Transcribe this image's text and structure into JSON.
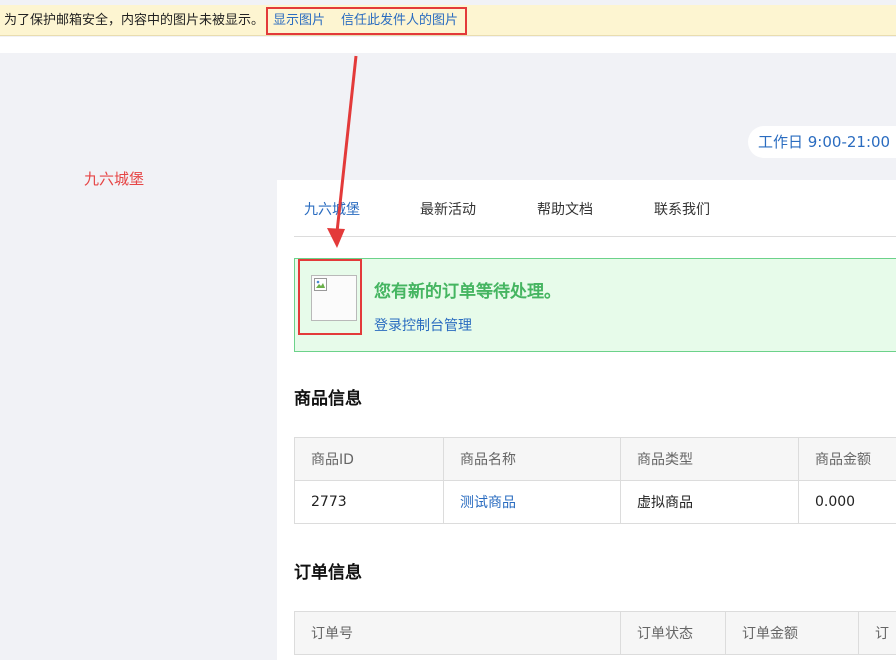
{
  "notice": {
    "text": "为了保护邮箱安全，内容中的图片未被显示。",
    "show_images": "显示图片",
    "trust_sender": "信任此发件人的图片"
  },
  "header": {
    "hours": "工作日 9:00-21:00",
    "brand": "九六城堡"
  },
  "nav": {
    "items": [
      "九六城堡",
      "最新活动",
      "帮助文档",
      "联系我们"
    ]
  },
  "alert": {
    "title": "您有新的订单等待处理。",
    "link": "登录控制台管理"
  },
  "product_section": {
    "title": "商品信息",
    "columns": [
      "商品ID",
      "商品名称",
      "商品类型",
      "商品金额"
    ],
    "row": [
      "2773",
      "测试商品",
      "虚拟商品",
      "0.000"
    ]
  },
  "order_section": {
    "title": "订单信息",
    "columns": [
      "订单号",
      "订单状态",
      "订单金额",
      "订"
    ]
  },
  "colors": {
    "accent_link": "#2a6cc0",
    "highlight_red": "#e33a3a",
    "success_green": "#45b561"
  }
}
